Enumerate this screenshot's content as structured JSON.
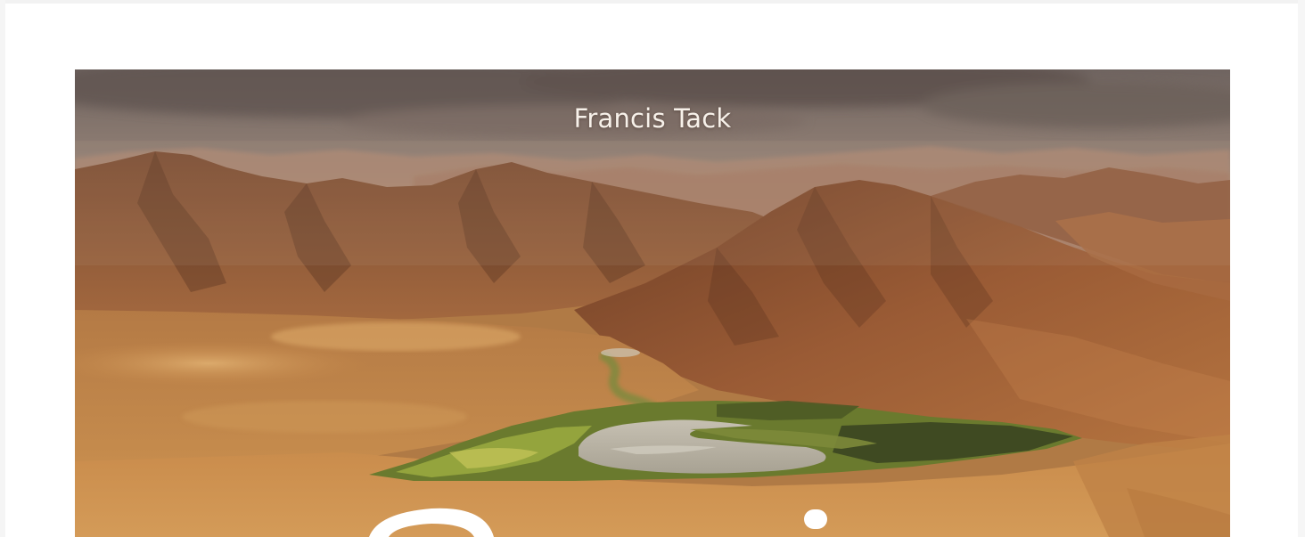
{
  "photo": {
    "credit": "Francis Tack",
    "colors": {
      "sky": "#8a7a70",
      "haze": "#b89a88",
      "mountain_dark": "#7a4a2e",
      "mountain_mid": "#9a5e38",
      "dune": "#c58a4c",
      "dune_light": "#d9a463",
      "oasis_green": "#6f8a34",
      "lake": "#b4aea0"
    }
  }
}
